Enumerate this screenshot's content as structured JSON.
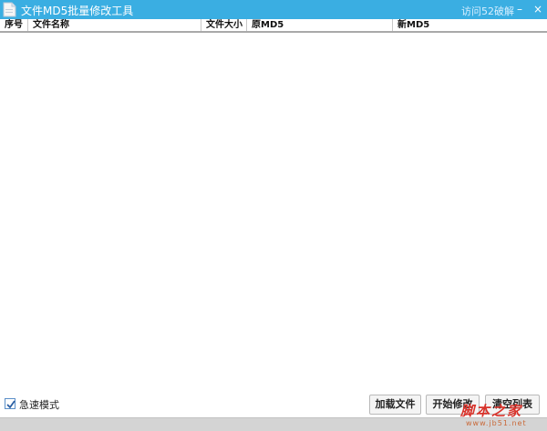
{
  "window": {
    "title": "文件MD5批量修改工具",
    "visit_link": "访问52破解",
    "minimize_glyph": "–",
    "close_glyph": "×"
  },
  "table": {
    "columns": [
      "序号",
      "文件名称",
      "文件大小",
      "原MD5",
      "新MD5"
    ],
    "rows": []
  },
  "options": {
    "fast_mode_label": "急速模式",
    "fast_mode_checked": true
  },
  "buttons": {
    "load_files": "加载文件",
    "start_modify": "开始修改",
    "clear_list": "清空列表"
  },
  "progress": {
    "value": 0
  },
  "watermark": {
    "main": "脚本之家",
    "sub": "www.jb51.net"
  },
  "colors": {
    "accent": "#3aaee2",
    "progress_track": "#d4d4d4",
    "watermark": "#d8322a"
  },
  "icons": {
    "app": "document-icon",
    "checkbox": "checkmark-icon"
  }
}
